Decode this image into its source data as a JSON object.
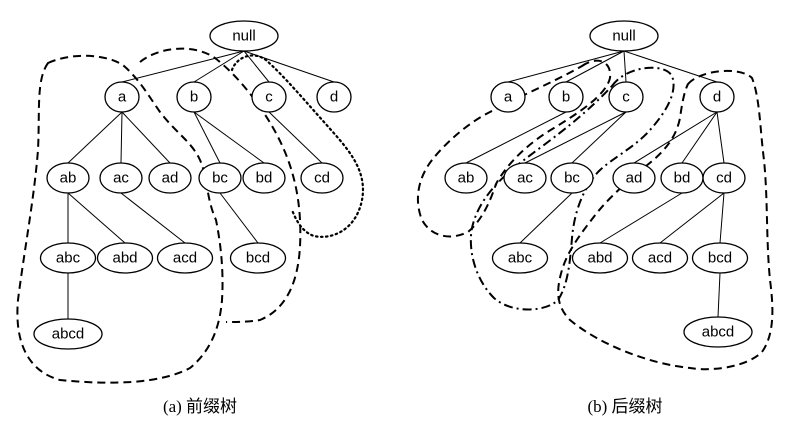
{
  "panels": [
    {
      "id": "a",
      "caption": "(a) 前缀树",
      "nodes": [
        {
          "id": "null",
          "label": "null"
        },
        {
          "id": "a",
          "label": "a"
        },
        {
          "id": "b",
          "label": "b"
        },
        {
          "id": "c",
          "label": "c"
        },
        {
          "id": "d",
          "label": "d"
        },
        {
          "id": "ab",
          "label": "ab"
        },
        {
          "id": "ac",
          "label": "ac"
        },
        {
          "id": "ad",
          "label": "ad"
        },
        {
          "id": "bc",
          "label": "bc"
        },
        {
          "id": "bd",
          "label": "bd"
        },
        {
          "id": "cd",
          "label": "cd"
        },
        {
          "id": "abc",
          "label": "abc"
        },
        {
          "id": "abd",
          "label": "abd"
        },
        {
          "id": "acd",
          "label": "acd"
        },
        {
          "id": "bcd",
          "label": "bcd"
        },
        {
          "id": "abcd",
          "label": "abcd"
        }
      ],
      "edges": [
        [
          "null",
          "a"
        ],
        [
          "null",
          "b"
        ],
        [
          "null",
          "c"
        ],
        [
          "null",
          "d"
        ],
        [
          "a",
          "ab"
        ],
        [
          "a",
          "ac"
        ],
        [
          "a",
          "ad"
        ],
        [
          "b",
          "bc"
        ],
        [
          "b",
          "bd"
        ],
        [
          "c",
          "cd"
        ],
        [
          "ab",
          "abc"
        ],
        [
          "ab",
          "abd"
        ],
        [
          "ac",
          "acd"
        ],
        [
          "bc",
          "bcd"
        ],
        [
          "abc",
          "abcd"
        ]
      ]
    },
    {
      "id": "b",
      "caption": "(b) 后缀树",
      "nodes": [
        {
          "id": "null",
          "label": "null"
        },
        {
          "id": "a",
          "label": "a"
        },
        {
          "id": "b",
          "label": "b"
        },
        {
          "id": "c",
          "label": "c"
        },
        {
          "id": "d",
          "label": "d"
        },
        {
          "id": "ab",
          "label": "ab"
        },
        {
          "id": "ac",
          "label": "ac"
        },
        {
          "id": "bc",
          "label": "bc"
        },
        {
          "id": "ad",
          "label": "ad"
        },
        {
          "id": "bd",
          "label": "bd"
        },
        {
          "id": "cd",
          "label": "cd"
        },
        {
          "id": "abc",
          "label": "abc"
        },
        {
          "id": "abd",
          "label": "abd"
        },
        {
          "id": "acd",
          "label": "acd"
        },
        {
          "id": "bcd",
          "label": "bcd"
        },
        {
          "id": "abcd",
          "label": "abcd"
        }
      ],
      "edges": [
        [
          "null",
          "a"
        ],
        [
          "null",
          "b"
        ],
        [
          "null",
          "c"
        ],
        [
          "null",
          "d"
        ],
        [
          "b",
          "ab"
        ],
        [
          "c",
          "ac"
        ],
        [
          "c",
          "bc"
        ],
        [
          "d",
          "ad"
        ],
        [
          "d",
          "bd"
        ],
        [
          "d",
          "cd"
        ],
        [
          "bc",
          "abc"
        ],
        [
          "bd",
          "abd"
        ],
        [
          "cd",
          "acd"
        ],
        [
          "cd",
          "bcd"
        ],
        [
          "bcd",
          "abcd"
        ]
      ]
    }
  ]
}
